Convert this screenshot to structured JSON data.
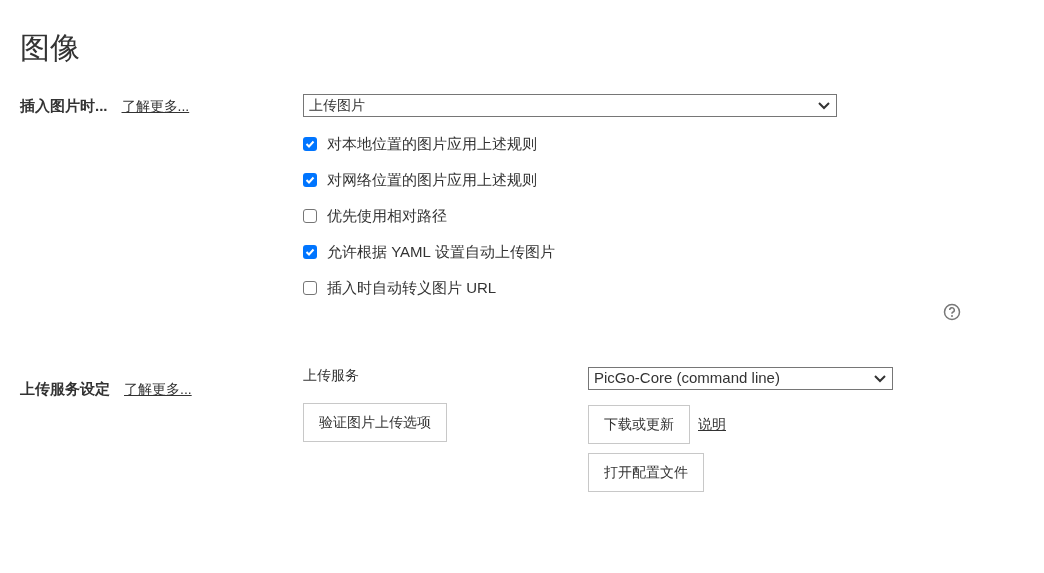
{
  "title": "图像",
  "insert_section": {
    "label": "插入图片时...",
    "learn_more": "了解更多...",
    "action_select": {
      "value": "上传图片"
    },
    "options": [
      {
        "label": "对本地位置的图片应用上述规则",
        "checked": true
      },
      {
        "label": "对网络位置的图片应用上述规则",
        "checked": true
      },
      {
        "label": "优先使用相对路径",
        "checked": false
      },
      {
        "label": "允许根据 YAML 设置自动上传图片",
        "checked": true
      },
      {
        "label": "插入时自动转义图片 URL",
        "checked": false
      }
    ]
  },
  "upload_section": {
    "label": "上传服务设定",
    "learn_more": "了解更多...",
    "service_label": "上传服务",
    "service_select": {
      "value": "PicGo-Core (command line)"
    },
    "verify_button": "验证图片上传选项",
    "update_button": "下载或更新",
    "help_link": "说明",
    "config_button": "打开配置文件"
  }
}
